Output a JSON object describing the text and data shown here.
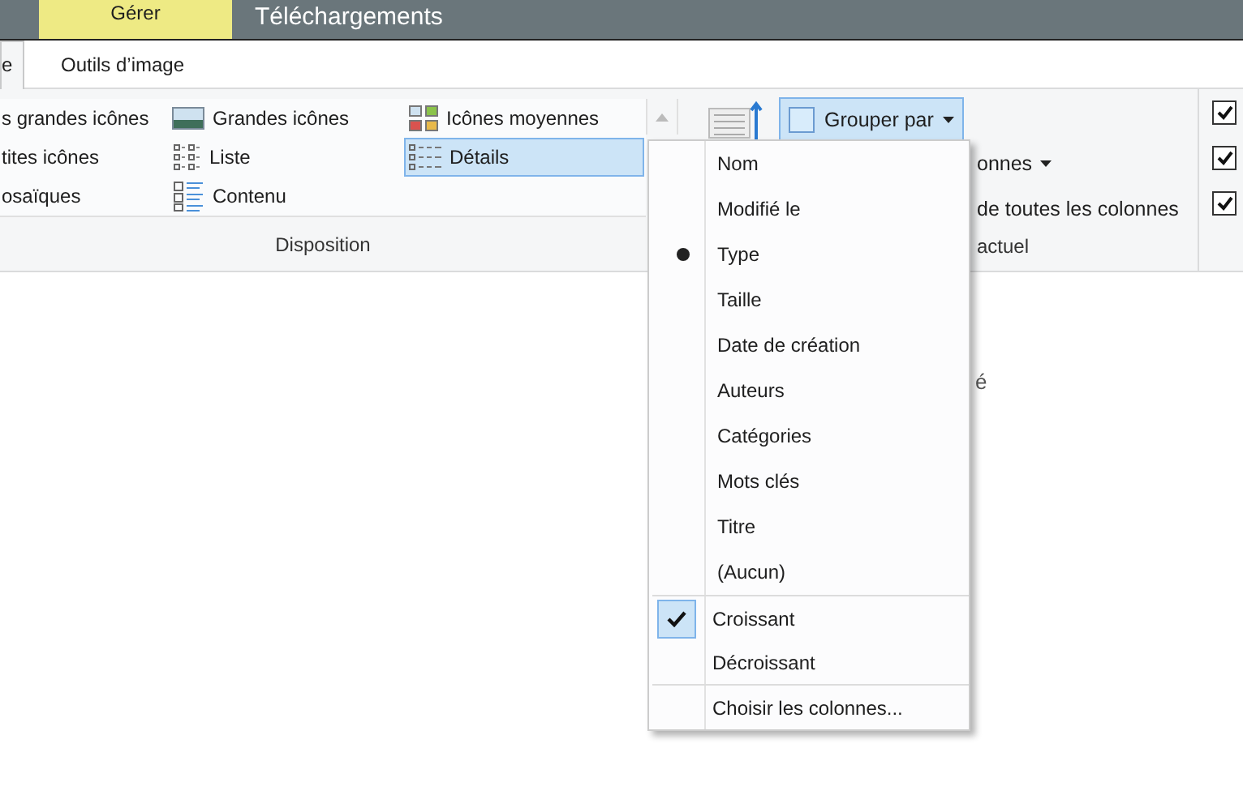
{
  "title_bar": {
    "context_tab": "Gérer",
    "title": "Téléchargements"
  },
  "ribbon_tabs": [
    {
      "label": "e",
      "selected": true
    },
    {
      "label": "Outils d’image",
      "selected": false
    }
  ],
  "layout_options": [
    {
      "label": "s grandes icônes",
      "kind": "clipped",
      "selected": false
    },
    {
      "label": "tites icônes",
      "kind": "clipped",
      "selected": false
    },
    {
      "label": "osaïques",
      "kind": "clipped",
      "selected": false
    },
    {
      "label": "Grandes icônes",
      "kind": "large",
      "selected": false
    },
    {
      "label": "Liste",
      "kind": "list",
      "selected": false
    },
    {
      "label": "Contenu",
      "kind": "content",
      "selected": false
    },
    {
      "label": "Icônes moyennes",
      "kind": "medium",
      "selected": false
    },
    {
      "label": "Détails",
      "kind": "details",
      "selected": true
    }
  ],
  "layout_group_label": "Disposition",
  "group_by_button": "Grouper par",
  "view_lines": [
    {
      "text": "onnes",
      "dropdown": true
    },
    {
      "text": "de toutes les colonnes",
      "dropdown": false
    }
  ],
  "view_group_label": "actuel",
  "checkboxes": [
    {
      "checked": true
    },
    {
      "checked": true
    },
    {
      "checked": true
    }
  ],
  "background_fragment": "é",
  "group_menu": {
    "sections": [
      {
        "items": [
          {
            "label": "Nom",
            "kind": "radio",
            "selected": false
          },
          {
            "label": "Modifié le",
            "kind": "radio",
            "selected": false
          },
          {
            "label": "Type",
            "kind": "radio",
            "selected": true
          },
          {
            "label": "Taille",
            "kind": "radio",
            "selected": false
          },
          {
            "label": "Date de création",
            "kind": "radio",
            "selected": false
          },
          {
            "label": "Auteurs",
            "kind": "radio",
            "selected": false
          },
          {
            "label": "Catégories",
            "kind": "radio",
            "selected": false
          },
          {
            "label": "Mots clés",
            "kind": "radio",
            "selected": false
          },
          {
            "label": "Titre",
            "kind": "radio",
            "selected": false
          },
          {
            "label": "(Aucun)",
            "kind": "radio",
            "selected": false
          }
        ]
      },
      {
        "items": [
          {
            "label": "Croissant",
            "kind": "check",
            "selected": true
          },
          {
            "label": "Décroissant",
            "kind": "check",
            "selected": false
          }
        ]
      },
      {
        "items": [
          {
            "label": "Choisir les colonnes...",
            "kind": "command"
          }
        ]
      }
    ]
  }
}
